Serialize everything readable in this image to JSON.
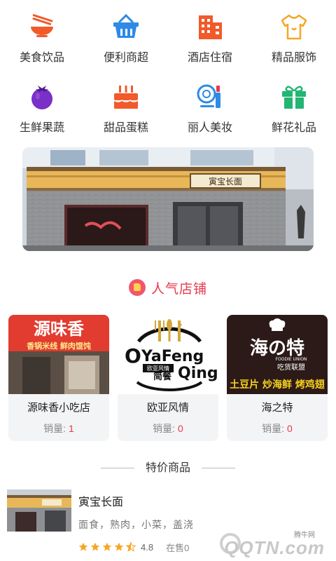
{
  "categories": [
    {
      "label": "美食饮品",
      "icon": "bowl-chopsticks-icon",
      "color": "#f15a2b"
    },
    {
      "label": "便利商超",
      "icon": "shopping-basket-icon",
      "color": "#2e8ae6"
    },
    {
      "label": "酒店住宿",
      "icon": "hotel-building-icon",
      "color": "#f15a2b"
    },
    {
      "label": "精品服饰",
      "icon": "tshirt-icon",
      "color": "#f5a623"
    },
    {
      "label": "生鲜果蔬",
      "icon": "eggplant-icon",
      "color": "#7b2fc9"
    },
    {
      "label": "甜品蛋糕",
      "icon": "cake-icon",
      "color": "#f15a2b"
    },
    {
      "label": "丽人美妆",
      "icon": "compact-mirror-icon",
      "color": "#2e8ae6"
    },
    {
      "label": "鲜花礼品",
      "icon": "gift-box-icon",
      "color": "#22b573"
    }
  ],
  "banner": {
    "sign_text": "寅宝长面"
  },
  "hot_shops": {
    "title": "人气店铺",
    "items": [
      {
        "name": "源味香小吃店",
        "sales_label": "销量:",
        "sales": "1",
        "sign_main": "源味香",
        "sign_sub": "香锅米线 鲜肉馄饨"
      },
      {
        "name": "欧亚风情",
        "sales_label": "销量:",
        "sales": "0",
        "logo_a": "YaFeng",
        "logo_b": "Qing",
        "logo_tag1": "欧亚风情",
        "logo_tag2": "简餐"
      },
      {
        "name": "海之特",
        "sales_label": "销量:",
        "sales": "0",
        "logo_main": "海の特",
        "logo_en": "FOODIE UNION",
        "logo_sub": "吃货联盟",
        "logo_bottom": "土豆片 炒海鲜 烤鸡翅"
      }
    ]
  },
  "deals": {
    "title": "特价商品",
    "product": {
      "name": "寅宝长面",
      "tags": "面食，熟肉，小菜，盖浇",
      "rating": "4.8",
      "stars_full": 4,
      "on_sale": "在售0"
    }
  },
  "watermark": {
    "small": "腾牛网",
    "big": "QQTN.com"
  },
  "colors": {
    "accent_red": "#e8384d",
    "card_bg": "#f3f4f6",
    "star": "#f5a623"
  }
}
